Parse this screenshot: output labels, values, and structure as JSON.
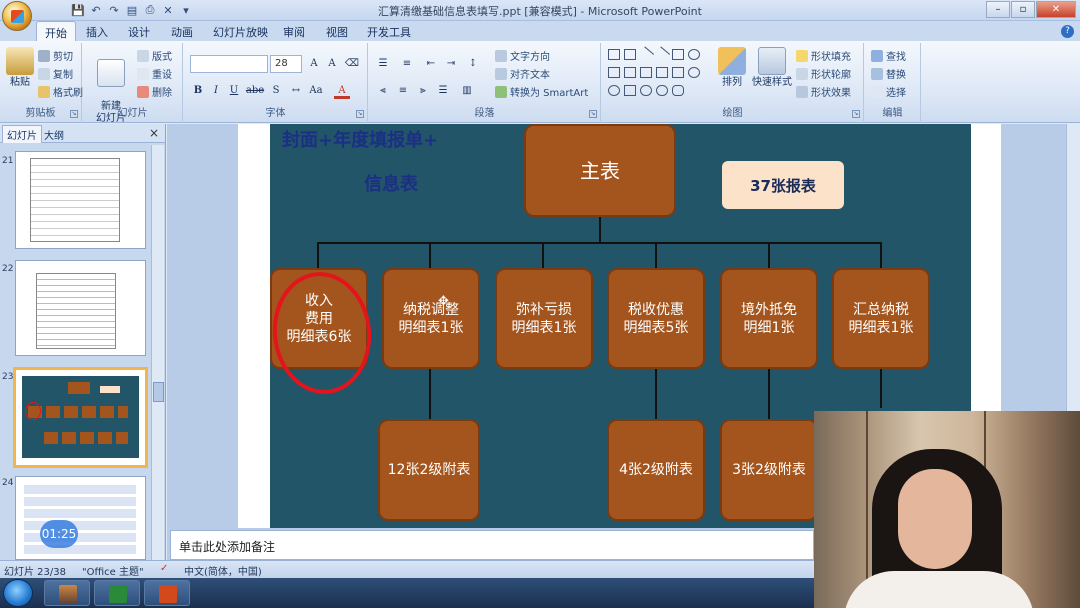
{
  "window": {
    "title": "汇算清缴基础信息表填写.ppt [兼容模式] - Microsoft PowerPoint",
    "controls": [
      "–",
      "▫",
      "✕"
    ]
  },
  "ribbon_tabs": [
    "开始",
    "插入",
    "设计",
    "动画",
    "幻灯片放映",
    "审阅",
    "视图",
    "开发工具"
  ],
  "ribbon": {
    "clipboard": {
      "label": "剪贴板",
      "paste": "粘贴",
      "cut": "剪切",
      "copy": "复制",
      "format_painter": "格式刷"
    },
    "slides": {
      "label": "幻灯片",
      "new_slide": "新建\n幻灯片",
      "layout": "版式",
      "reset": "重设",
      "delete": "删除"
    },
    "font": {
      "label": "字体",
      "font_name": "",
      "font_size": "28",
      "bold": "B",
      "italic": "I",
      "underline": "U",
      "strike": "abe",
      "shadow": "S"
    },
    "paragraph": {
      "label": "段落",
      "text_direction": "文字方向",
      "align_text": "对齐文本",
      "smartart": "转换为 SmartArt"
    },
    "drawing": {
      "label": "绘图",
      "arrange": "排列",
      "quick_styles": "快速样式",
      "shape_fill": "形状填充",
      "shape_outline": "形状轮廓",
      "shape_effects": "形状效果"
    },
    "editing": {
      "label": "编辑",
      "find": "查找",
      "replace": "替换",
      "select": "选择"
    }
  },
  "pane": {
    "tabs": [
      "幻灯片",
      "大纲"
    ],
    "close": "×",
    "thumbs": [
      {
        "num": "21",
        "selected": false
      },
      {
        "num": "22",
        "selected": false
      },
      {
        "num": "23",
        "selected": true
      },
      {
        "num": "24",
        "selected": false
      }
    ],
    "time_badge": "01:25"
  },
  "slide": {
    "title_line1": "封面+年度填报单+",
    "title_line2": "信息表",
    "root": "主表",
    "count_badge": "37张报表",
    "children": [
      {
        "label": "收入\n费用\n明细表6张",
        "circled": true
      },
      {
        "label": "纳税调整\n明细表1张"
      },
      {
        "label": "弥补亏损\n明细表1张"
      },
      {
        "label": "税收优惠\n明细表5张"
      },
      {
        "label": "境外抵免\n明细1张"
      },
      {
        "label": "汇总纳税\n明细表1张"
      }
    ],
    "sub_nodes": [
      {
        "parent": "纳税调整",
        "label": "12张2级附表"
      },
      {
        "parent": "税收优惠",
        "label": "4张2级附表"
      },
      {
        "parent": "境外抵免",
        "label": "3张2级附表"
      }
    ]
  },
  "notes_placeholder": "单击此处添加备注",
  "status": {
    "slide_info": "幻灯片 23/38",
    "theme": "\"Office 主题\"",
    "language": "中文(简体，中国)"
  },
  "colors": {
    "slide_background": "#225567",
    "node_fill": "#a4551d",
    "annotation_red": "#e3141c",
    "title_blue": "#1b2f86"
  }
}
